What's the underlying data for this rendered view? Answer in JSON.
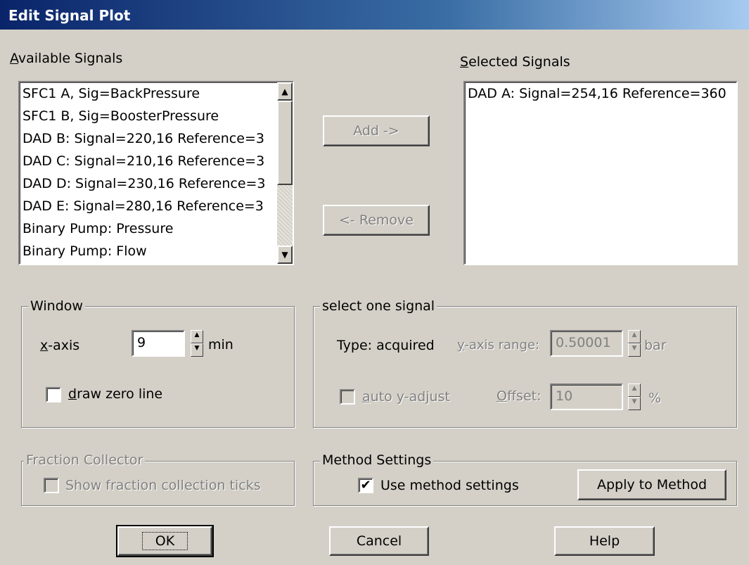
{
  "window": {
    "title": "Edit Signal Plot"
  },
  "available_signals": {
    "label": "Available Signals",
    "items": [
      "SFC1 A, Sig=BackPressure",
      "SFC1 B, Sig=BoosterPressure",
      "DAD B: Signal=220,16  Reference=3",
      "DAD C: Signal=210,16  Reference=3",
      "DAD D: Signal=230,16  Reference=3",
      "DAD E: Signal=280,16  Reference=3",
      "Binary Pump: Pressure",
      "Binary Pump: Flow"
    ]
  },
  "selected_signals": {
    "label": "Selected Signals",
    "items": [
      "DAD A: Signal=254,16  Reference=360"
    ]
  },
  "buttons": {
    "add": "Add ->",
    "remove": "<- Remove",
    "ok": "OK",
    "cancel": "Cancel",
    "help": "Help",
    "apply": "Apply to Method"
  },
  "window_group": {
    "legend": "Window",
    "xaxis_label": "x-axis",
    "xaxis_value": "9",
    "xaxis_unit": "min",
    "draw_zero_line": "draw zero line",
    "draw_zero_checked": false
  },
  "signal_group": {
    "legend": "select one signal",
    "type_label": "Type:  acquired",
    "yrange_label": "y-axis range:",
    "yrange_value": "0.50001",
    "yrange_unit": "bar",
    "auto_adjust": "auto y-adjust",
    "offset_label": "Offset:",
    "offset_value": "10",
    "offset_unit": "%"
  },
  "fraction_group": {
    "legend": "Fraction Collector",
    "show_ticks": "Show fraction collection ticks"
  },
  "method_group": {
    "legend": "Method Settings",
    "use_method": "Use method settings",
    "use_method_checked": true
  }
}
